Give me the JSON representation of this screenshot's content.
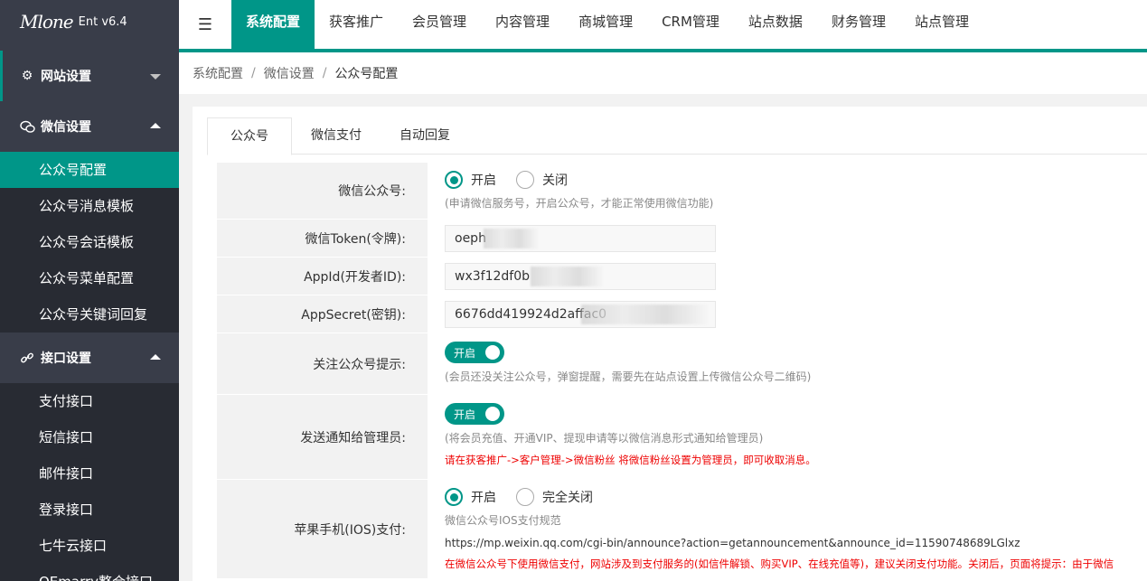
{
  "app": {
    "logo_text": "Mlone",
    "version": "Ent v6.4"
  },
  "sidebar": {
    "group1": {
      "label": "网站设置",
      "icon": "gear-icon"
    },
    "group2": {
      "label": "微信设置",
      "icon": "wechat-icon"
    },
    "wechat_items": [
      "公众号配置",
      "公众号消息模板",
      "公众号会话模板",
      "公众号菜单配置",
      "公众号关键词回复"
    ],
    "group3": {
      "label": "接口设置",
      "icon": "link-icon"
    },
    "api_items": [
      "支付接口",
      "短信接口",
      "邮件接口",
      "登录接口",
      "七牛云接口",
      "QEmarry整合接口"
    ]
  },
  "topnav": {
    "items": [
      "系统配置",
      "获客推广",
      "会员管理",
      "内容管理",
      "商城管理",
      "CRM管理",
      "站点数据",
      "财务管理",
      "站点管理"
    ]
  },
  "breadcrumb": {
    "a": "系统配置",
    "b": "微信设置",
    "c": "公众号配置",
    "sep": "/"
  },
  "tabs": [
    "公众号",
    "微信支付",
    "自动回复"
  ],
  "form": {
    "mp": {
      "label": "微信公众号:",
      "on": "开启",
      "off": "关闭",
      "hint": "(申请微信服务号，开启公众号，才能正常使用微信功能)"
    },
    "token": {
      "label": "微信Token(令牌):",
      "value": "oeph"
    },
    "appid": {
      "label": "AppId(开发者ID):",
      "value": "wx3f12df0b"
    },
    "secret": {
      "label": "AppSecret(密钥):",
      "value": "6676dd419924d2affac0"
    },
    "follow": {
      "label": "关注公众号提示:",
      "switch": "开启",
      "hint": "(会员还没关注公众号，弹窗提醒，需要先在站点设置上传微信公众号二维码)"
    },
    "notify": {
      "label": "发送通知给管理员:",
      "switch": "开启",
      "hint": "(将会员充值、开通VIP、提现申请等以微信消息形式通知给管理员)",
      "warn": "请在获客推广->客户管理->微信粉丝 将微信粉丝设置为管理员，即可收取消息。"
    },
    "ios": {
      "label": "苹果手机(IOS)支付:",
      "on": "开启",
      "off": "完全关闭",
      "hint": "微信公众号IOS支付规范",
      "url": "https://mp.weixin.qq.com/cgi-bin/announce?action=getannouncement&announce_id=11590748689LGlxz",
      "warn": "在微信公众号下使用微信支付，网站涉及到支付服务的(如信件解锁、购买VIP、在线充值等)，建议关闭支付功能。关闭后，页面将提示：由于微信"
    }
  },
  "colors": {
    "accent": "#009688",
    "sidebar_bg": "#393d49",
    "sidebar_sub_bg": "#282b33"
  }
}
